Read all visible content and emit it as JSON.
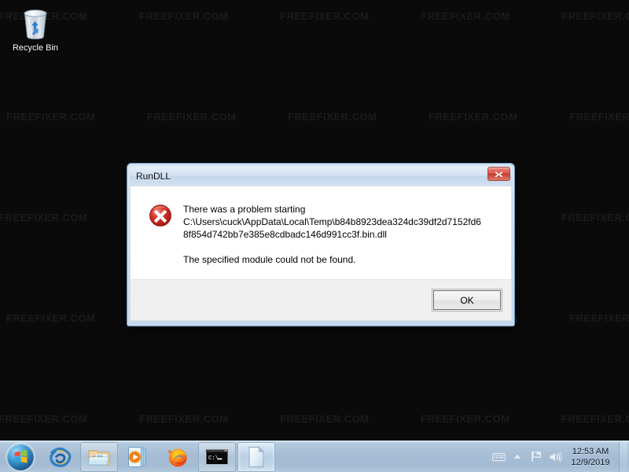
{
  "desktop": {
    "background_color": "#0a0a0a",
    "watermark_text": "FREEFIXER.COM",
    "watermark_color": "#1b1b1b",
    "icons": [
      {
        "name": "recycle-bin",
        "label": "Recycle Bin"
      }
    ]
  },
  "dialog": {
    "title": "RunDLL",
    "close_button_label": "x",
    "icon": "error-icon",
    "message_lines": [
      "There was a problem starting",
      "C:\\Users\\cuck\\AppData\\Local\\Temp\\b84b8923dea324dc39df2d7152fd6",
      "8f854d742bb7e385e8cdbadc146d991cc3f.bin.dll"
    ],
    "message_secondary": "The specified module could not be found.",
    "full_path": "C:\\Users\\cuck\\AppData\\Local\\Temp\\b84b8923dea324dc39df2d7152fd68f854d742bb7e385e8cdbadc146d991cc3f.bin.dll",
    "ok_label": "OK",
    "accent_color": "#c33a2d",
    "titlebar_color": "#d2e2f3"
  },
  "taskbar": {
    "background_color": "#a6bdd4",
    "start_button": "start-orb",
    "items": [
      {
        "name": "internet-explorer-icon",
        "label": "Internet Explorer",
        "state": "pinned"
      },
      {
        "name": "windows-explorer-icon",
        "label": "Windows Explorer",
        "state": "framed"
      },
      {
        "name": "windows-media-player-icon",
        "label": "Windows Media Player",
        "state": "pinned"
      },
      {
        "name": "firefox-icon",
        "label": "Mozilla Firefox",
        "state": "pinned"
      },
      {
        "name": "command-prompt-icon",
        "label": "Command Prompt",
        "state": "framed"
      },
      {
        "name": "rundll-window-icon",
        "label": "RunDLL",
        "state": "active"
      }
    ],
    "tray": [
      {
        "name": "keyboard-icon",
        "label": "Input language"
      },
      {
        "name": "show-hidden-icons-icon",
        "label": "Show hidden icons"
      },
      {
        "name": "network-flag-icon",
        "label": "Network"
      },
      {
        "name": "volume-icon",
        "label": "Volume"
      }
    ],
    "clock": {
      "time": "12:53 AM",
      "date": "12/9/2019"
    },
    "show_desktop_label": "Show desktop"
  }
}
